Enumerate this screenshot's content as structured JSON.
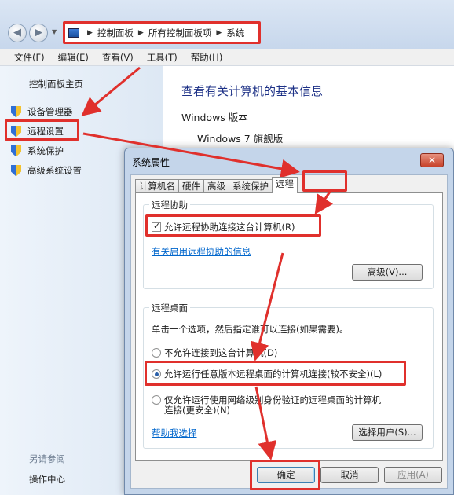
{
  "explorer": {
    "breadcrumb": [
      "控制面板",
      "所有控制面板项",
      "系统"
    ],
    "menu": [
      "文件(F)",
      "编辑(E)",
      "查看(V)",
      "工具(T)",
      "帮助(H)"
    ],
    "left_pane": {
      "home": "控制面板主页",
      "items": [
        "设备管理器",
        "远程设置",
        "系统保护",
        "高级系统设置"
      ],
      "see_also": "另请参阅",
      "action_center": "操作中心"
    },
    "main": {
      "title": "查看有关计算机的基本信息",
      "section": "Windows 版本",
      "edition": "Windows 7 旗舰版"
    }
  },
  "dialog": {
    "title": "系统属性",
    "close": "✕",
    "tabs": [
      "计算机名",
      "硬件",
      "高级",
      "系统保护",
      "远程"
    ],
    "active_tab": "远程",
    "remote_assistance": {
      "group_title": "远程协助",
      "checkbox_label": "允许远程协助连接这台计算机(R)",
      "checked": true,
      "info_link": "有关启用远程协助的信息",
      "advanced_button": "高级(V)..."
    },
    "remote_desktop": {
      "group_title": "远程桌面",
      "instruction": "单击一个选项，然后指定谁可以连接(如果需要)。",
      "options": [
        "不允许连接到这台计算机(D)",
        "允许运行任意版本远程桌面的计算机连接(较不安全)(L)",
        "仅允许运行使用网络级别身份验证的远程桌面的计算机连接(更安全)(N)"
      ],
      "selected_option": 1,
      "help_link": "帮助我选择",
      "select_users_button": "选择用户(S)..."
    },
    "buttons": {
      "ok": "确定",
      "cancel": "取消",
      "apply": "应用(A)"
    }
  },
  "colors": {
    "highlight": "#e0302c",
    "link": "#0066cc",
    "title_blue": "#1e3287"
  }
}
